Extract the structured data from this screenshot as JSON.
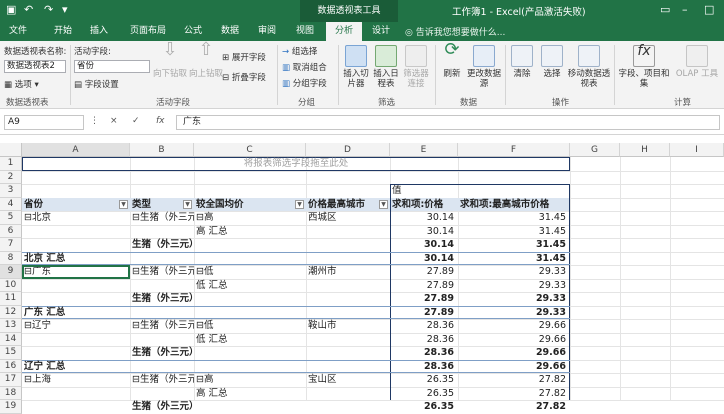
{
  "titlebar": {
    "context_tab": "数据透视表工具",
    "window_title": "工作簿1 - Excel(产品激活失败)",
    "undo_icon": "undo-icon",
    "redo_icon": "redo-icon"
  },
  "tabs": [
    "文件",
    "开始",
    "插入",
    "页面布局",
    "公式",
    "数据",
    "审阅",
    "视图",
    "分析",
    "设计"
  ],
  "active_tab": "分析",
  "tellme": "告诉我您想要做什么...",
  "ribbon": {
    "pivot_name_label": "数据透视表名称:",
    "pivot_name_value": "数据透视表2",
    "options": "选项",
    "group_pivot": "数据透视表",
    "active_field_label": "活动字段:",
    "active_field_value": "省份",
    "field_settings": "字段设置",
    "drill_down": "向下钻取",
    "drill_up": "向上钻取",
    "expand_field": "展开字段",
    "collapse_field": "折叠字段",
    "group_active_field": "活动字段",
    "group_selection": "组选择",
    "ungroup": "取消组合",
    "group_field": "分组字段",
    "group_group": "分组",
    "insert_slicer": "插入切片器",
    "insert_timeline": "插入日程表",
    "filter_connections": "筛选器连接",
    "group_filter": "筛选",
    "refresh": "刷新",
    "change_source": "更改数据源",
    "group_data": "数据",
    "clear": "清除",
    "select": "选择",
    "move_pivot": "移动数据透视表",
    "group_actions": "操作",
    "fields_items": "字段、项目和集",
    "olap_tools": "OLAP 工具",
    "group_calc": "计算"
  },
  "formula_bar": {
    "name_box": "A9",
    "cancel": "×",
    "confirm": "✓",
    "fx": "fx",
    "content": "广东"
  },
  "columns": [
    "A",
    "B",
    "C",
    "D",
    "E",
    "F",
    "G",
    "H",
    "I"
  ],
  "row_numbers": [
    "1",
    "2",
    "3",
    "4",
    "5",
    "6",
    "7",
    "8",
    "9",
    "10",
    "11",
    "12",
    "13",
    "14",
    "15",
    "16",
    "17",
    "18",
    "19"
  ],
  "sheet": {
    "filter_drop_hint": "将报表筛选字段拖至此处",
    "values_label": "值",
    "headers": {
      "province": "省份",
      "type": "类型",
      "avg_level": "较全国均价",
      "max_city": "价格最高城市",
      "sum_price": "求和项:价格",
      "sum_max_price": "求和项:最高城市价格"
    },
    "rows": [
      {
        "a": "⊟北京",
        "b": "⊟生猪（外三元",
        "c": "⊟高",
        "d": "西城区",
        "e": "30.14",
        "f": "31.45",
        "bold": false
      },
      {
        "a": "",
        "b": "",
        "c": "高 汇总",
        "d": "",
        "e": "30.14",
        "f": "31.45",
        "bold": false
      },
      {
        "a": "",
        "b": "生猪（外三元）汇总",
        "c": "",
        "d": "",
        "e": "30.14",
        "f": "31.45",
        "bold": true
      },
      {
        "a": "北京 汇总",
        "b": "",
        "c": "",
        "d": "",
        "e": "30.14",
        "f": "31.45",
        "bold": true
      },
      {
        "a": "⊟广东",
        "b": "⊟生猪（外三元",
        "c": "⊟低",
        "d": "潮州市",
        "e": "27.89",
        "f": "29.33",
        "bold": false
      },
      {
        "a": "",
        "b": "",
        "c": "低 汇总",
        "d": "",
        "e": "27.89",
        "f": "29.33",
        "bold": false
      },
      {
        "a": "",
        "b": "生猪（外三元）汇总",
        "c": "",
        "d": "",
        "e": "27.89",
        "f": "29.33",
        "bold": true
      },
      {
        "a": "广东 汇总",
        "b": "",
        "c": "",
        "d": "",
        "e": "27.89",
        "f": "29.33",
        "bold": true
      },
      {
        "a": "⊟辽宁",
        "b": "⊟生猪（外三元",
        "c": "⊟低",
        "d": "鞍山市",
        "e": "28.36",
        "f": "29.66",
        "bold": false
      },
      {
        "a": "",
        "b": "",
        "c": "低 汇总",
        "d": "",
        "e": "28.36",
        "f": "29.66",
        "bold": false
      },
      {
        "a": "",
        "b": "生猪（外三元）汇总",
        "c": "",
        "d": "",
        "e": "28.36",
        "f": "29.66",
        "bold": true
      },
      {
        "a": "辽宁 汇总",
        "b": "",
        "c": "",
        "d": "",
        "e": "28.36",
        "f": "29.66",
        "bold": true
      },
      {
        "a": "⊟上海",
        "b": "⊟生猪（外三元",
        "c": "⊟高",
        "d": "宝山区",
        "e": "26.35",
        "f": "27.82",
        "bold": false
      },
      {
        "a": "",
        "b": "",
        "c": "高 汇总",
        "d": "",
        "e": "26.35",
        "f": "27.82",
        "bold": false
      },
      {
        "a": "",
        "b": "生猪（外三元）汇总",
        "c": "",
        "d": "",
        "e": "26.35",
        "f": "27.82",
        "bold": true
      }
    ]
  }
}
